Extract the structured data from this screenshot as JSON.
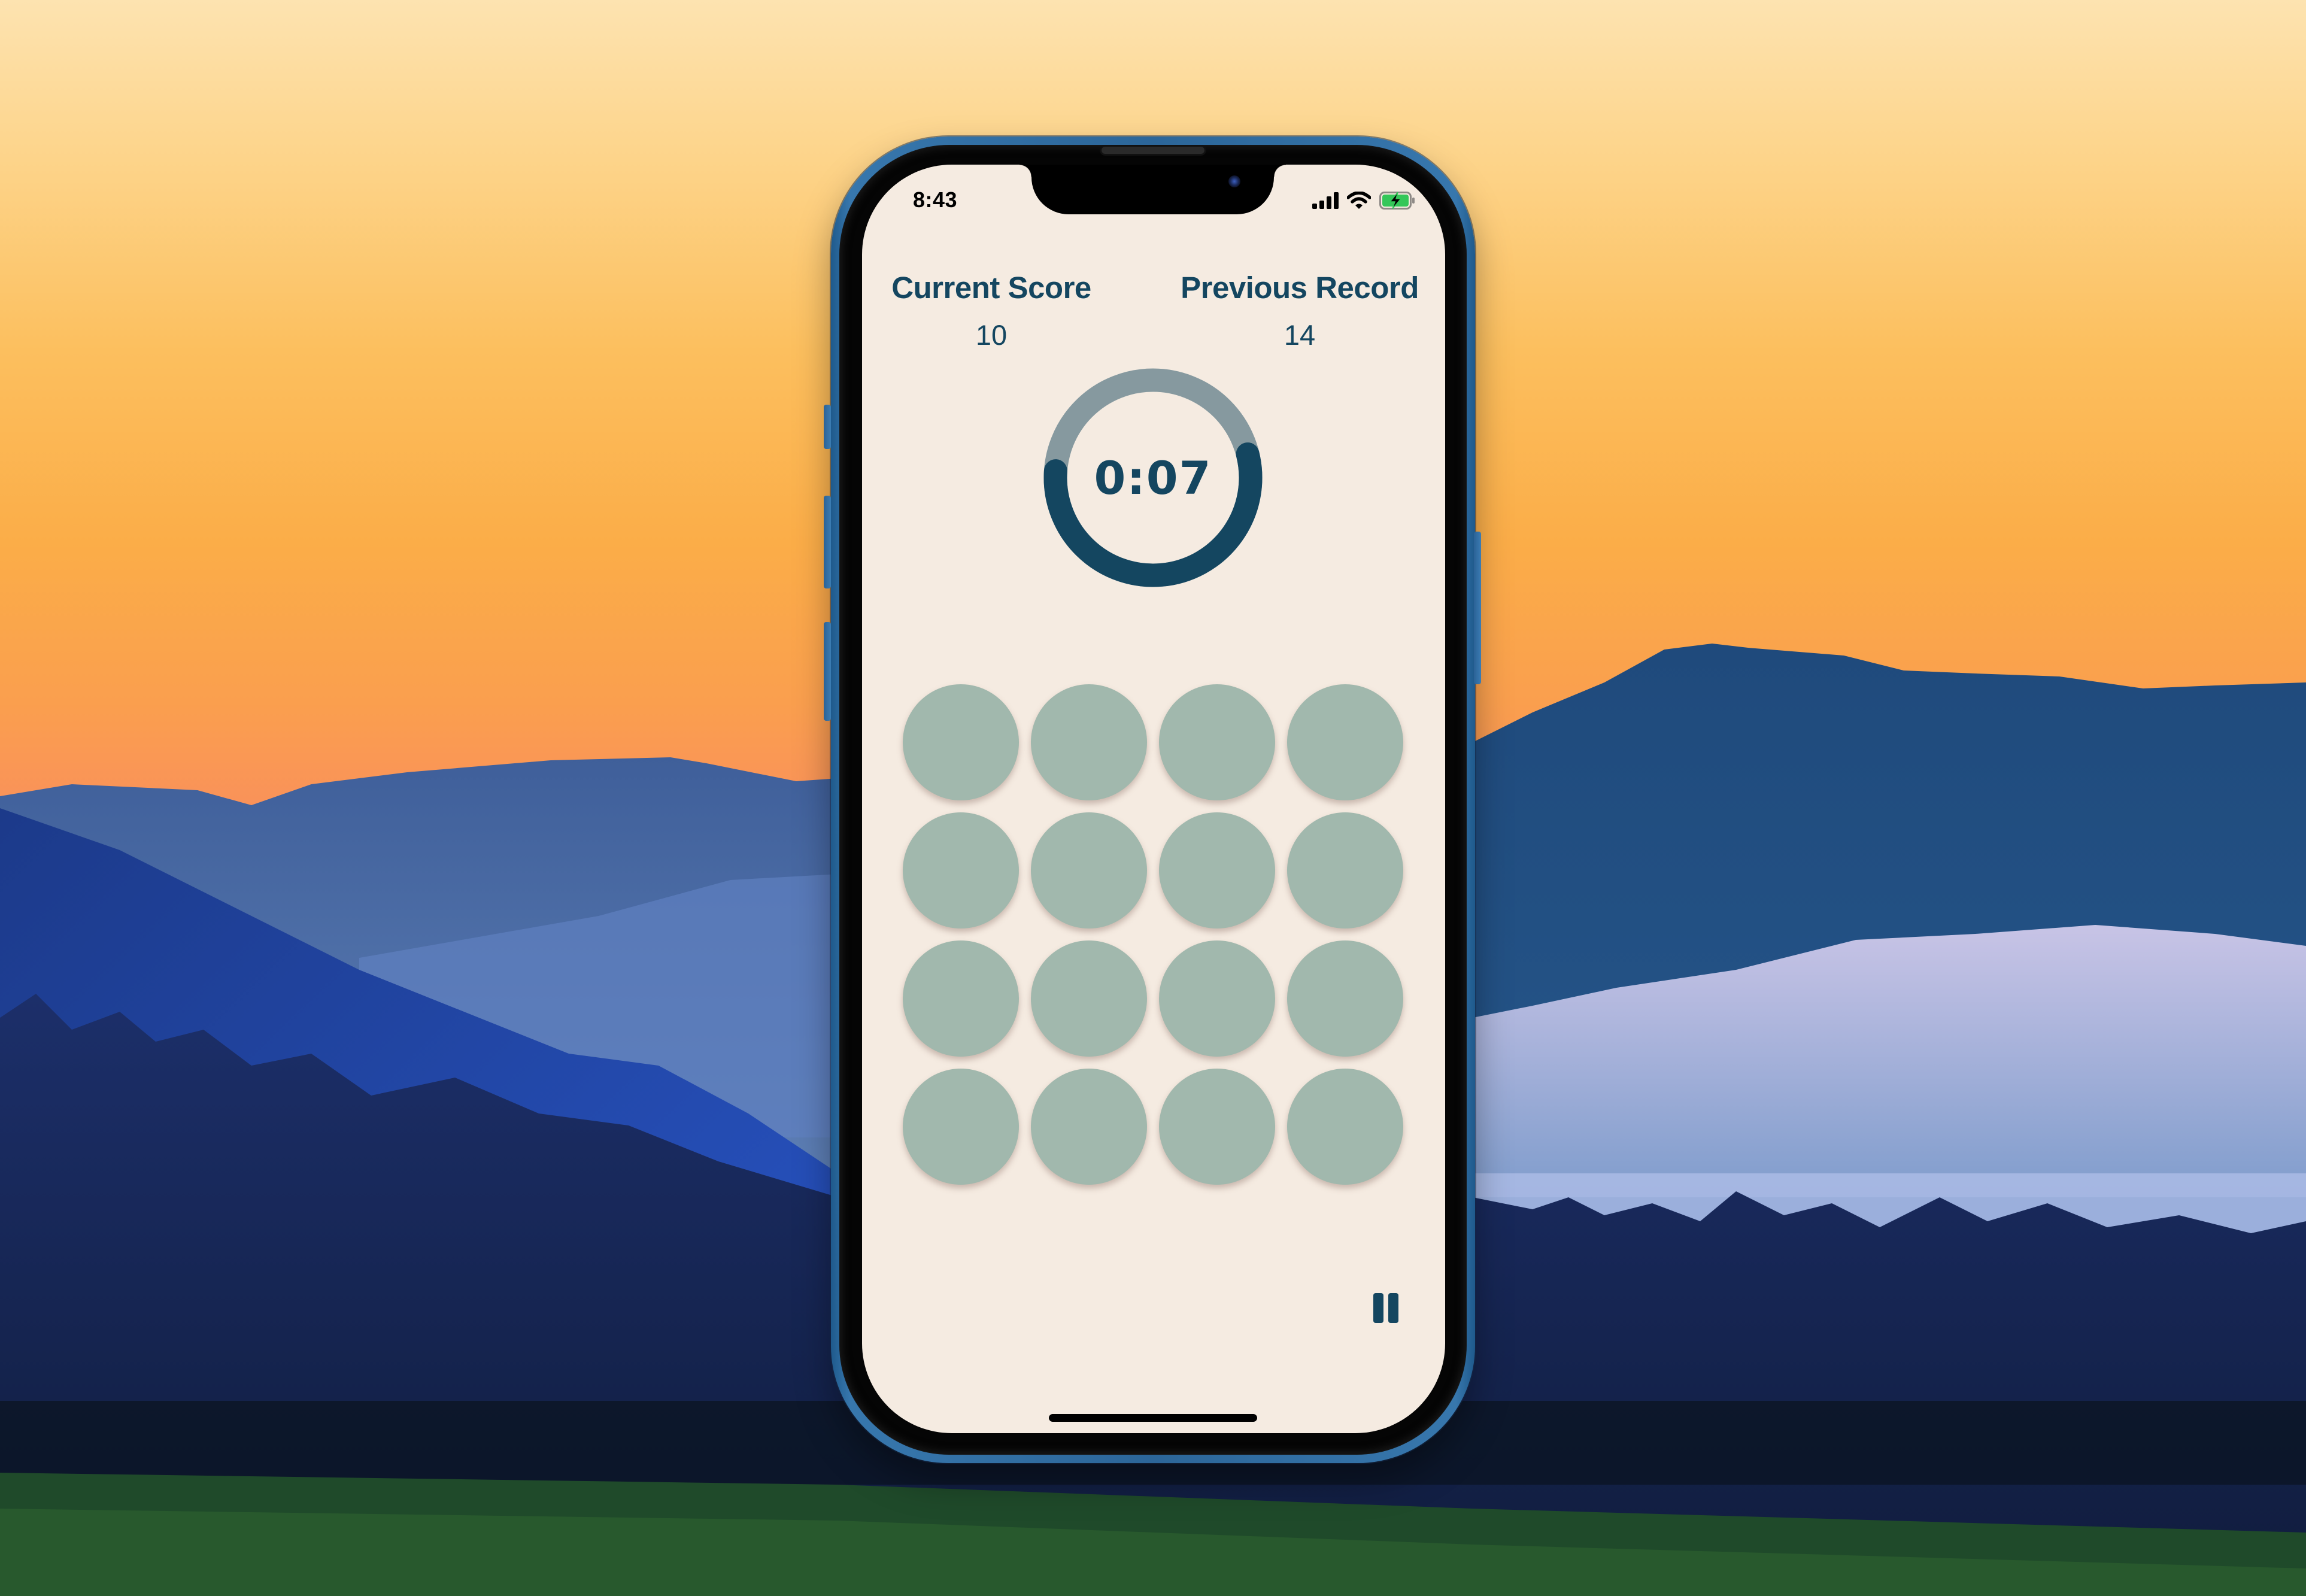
{
  "status_bar": {
    "time": "8:43",
    "icons": [
      "cellular-signal-icon",
      "wifi-icon",
      "battery-charging-icon"
    ],
    "battery_color": "#34c759"
  },
  "scores": {
    "current": {
      "label": "Current Score",
      "value": "10"
    },
    "record": {
      "label": "Previous Record",
      "value": "14"
    }
  },
  "timer": {
    "text": "0:07",
    "progress_fraction": 0.55,
    "track_color": "#86999f",
    "progress_color": "#144660"
  },
  "grid": {
    "rows": 4,
    "cols": 4,
    "tile_color": "#a1b8ad",
    "tiles": [
      {
        "state": "idle"
      },
      {
        "state": "idle"
      },
      {
        "state": "idle"
      },
      {
        "state": "idle"
      },
      {
        "state": "idle"
      },
      {
        "state": "idle"
      },
      {
        "state": "idle"
      },
      {
        "state": "idle"
      },
      {
        "state": "idle"
      },
      {
        "state": "idle"
      },
      {
        "state": "idle"
      },
      {
        "state": "idle"
      },
      {
        "state": "idle"
      },
      {
        "state": "idle"
      },
      {
        "state": "idle"
      },
      {
        "state": "idle"
      }
    ]
  },
  "controls": {
    "pause_icon": "pause-icon"
  },
  "theme": {
    "screen_background": "#f5ebe1",
    "text_color": "#144660",
    "phone_frame_color": "#2c6699"
  }
}
